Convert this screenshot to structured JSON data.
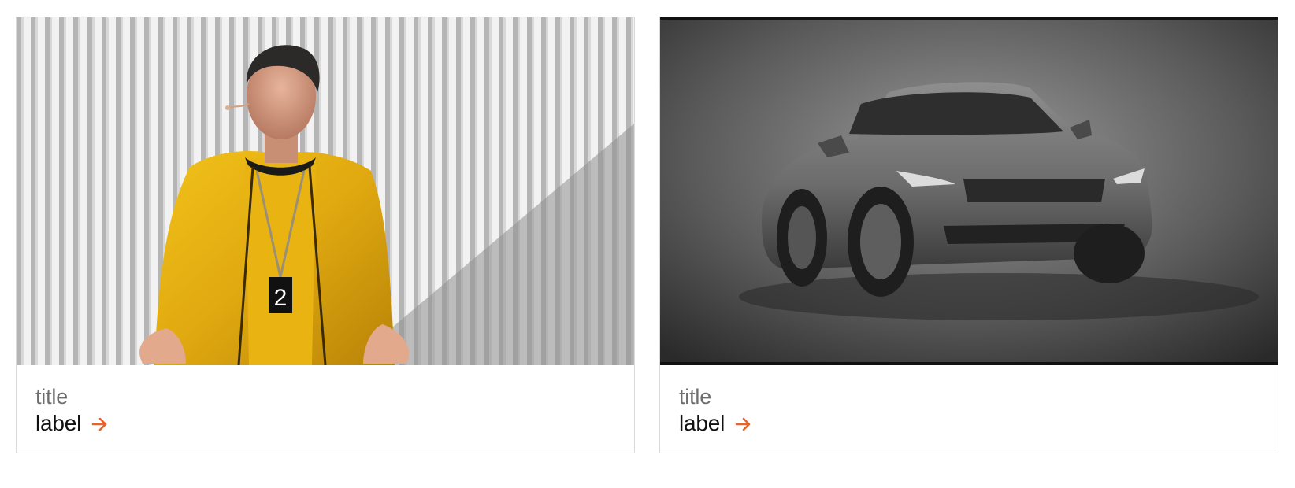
{
  "cards": [
    {
      "title": "title",
      "label": "label",
      "image_icon": "presenter-photo",
      "link_icon": "arrow-right-icon",
      "badge_number": "2"
    },
    {
      "title": "title",
      "label": "label",
      "image_icon": "car-photo",
      "link_icon": "arrow-right-icon"
    }
  ],
  "colors": {
    "accent": "#e8632a",
    "title": "#6e6e6e",
    "label": "#111111",
    "border": "#d9d9d9"
  }
}
